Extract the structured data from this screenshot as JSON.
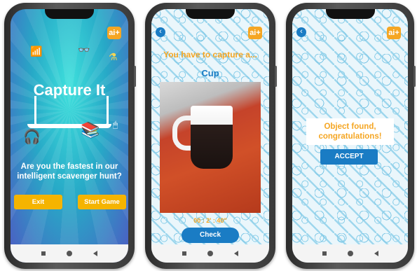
{
  "brand": {
    "logo": "ai+",
    "accent": "#f5a623",
    "primary": "#1a7cc4"
  },
  "screen1": {
    "title": "Capture It",
    "question": "Are you the fastest in our intelligent scavenger hunt?",
    "exit_label": "Exit",
    "start_label": "Start Game"
  },
  "screen2": {
    "back": "‹",
    "header": "You have to capture a...",
    "object": "Cup",
    "timer": "00 : 2' : 40\"",
    "check_label": "Check"
  },
  "screen3": {
    "back": "‹",
    "message": "Object found, congratulations!",
    "accept_label": "ACCEPT"
  }
}
